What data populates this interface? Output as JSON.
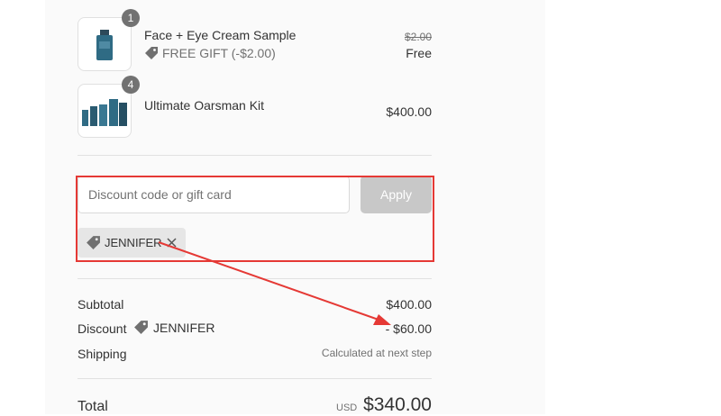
{
  "items": [
    {
      "name": "Face + Eye Cream Sample",
      "quantity": "1",
      "gift_label": "FREE GIFT (-$2.00)",
      "original_price": "$2.00",
      "price": "Free"
    },
    {
      "name": "Ultimate Oarsman Kit",
      "quantity": "4",
      "price": "$400.00"
    }
  ],
  "discount_form": {
    "placeholder": "Discount code or gift card",
    "apply_label": "Apply",
    "applied_code": "JENNIFER"
  },
  "summary": {
    "subtotal_label": "Subtotal",
    "subtotal_value": "$400.00",
    "discount_label": "Discount",
    "discount_code": "JENNIFER",
    "discount_value": "- $60.00",
    "shipping_label": "Shipping",
    "shipping_value": "Calculated at next step",
    "total_label": "Total",
    "total_currency": "USD",
    "total_value": "$340.00"
  },
  "colors": {
    "annotation": "#e53935",
    "panel_bg": "#fafafa",
    "apply_disabled": "#c8c8c8"
  },
  "icons": [
    "tag-icon",
    "close-icon",
    "arrow-annotation"
  ]
}
